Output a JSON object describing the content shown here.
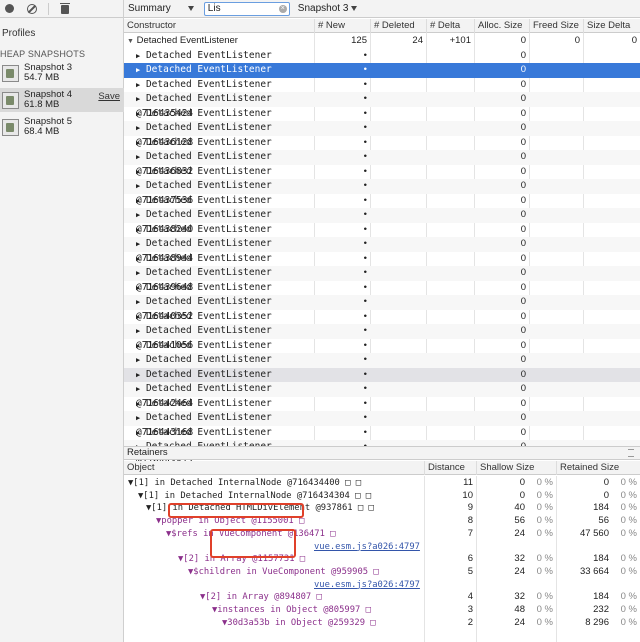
{
  "sidebar": {
    "profiles_label": "Profiles",
    "heap_label": "HEAP SNAPSHOTS",
    "snapshots": [
      {
        "name": "Snapshot 3",
        "size": "54.7 MB"
      },
      {
        "name": "Snapshot 4",
        "size": "61.8 MB",
        "save": "Save"
      },
      {
        "name": "Snapshot 5",
        "size": "68.4 MB"
      }
    ]
  },
  "toolbar": {
    "view": "Summary",
    "filter_value": "Lis",
    "compare": "Snapshot 3"
  },
  "table": {
    "headers": [
      "Constructor",
      "# New",
      "# Deleted",
      "# Delta",
      "Alloc. Size",
      "Freed Size",
      "Size Delta"
    ],
    "group": {
      "name": "Detached EventListener",
      "new": "125",
      "deleted": "24",
      "delta": "+101",
      "alloc": "0",
      "freed": "0",
      "size_delta": "0"
    },
    "rows": [
      "Detached EventListener @716434528",
      "Detached EventListener @716434720",
      "Detached EventListener @716435232",
      "Detached EventListener @716435424",
      "Detached EventListener @716435936",
      "Detached EventListener @716436128",
      "Detached EventListener @716436640",
      "Detached EventListener @716436832",
      "Detached EventListener @716437344",
      "Detached EventListener @716437536",
      "Detached EventListener @716438048",
      "Detached EventListener @716438240",
      "Detached EventListener @716438752",
      "Detached EventListener @716438944",
      "Detached EventListener @716439456",
      "Detached EventListener @716439648",
      "Detached EventListener @716440160",
      "Detached EventListener @716440352",
      "Detached EventListener @716440864",
      "Detached EventListener @716441056",
      "Detached EventListener @716441568",
      "Detached EventListener @716441760",
      "Detached EventListener @716442272",
      "Detached EventListener @716442464",
      "Detached EventListener @716442976",
      "Detached EventListener @716443168",
      "Detached EventListener @716443680",
      "Detached EventListener @716443872"
    ],
    "row_new": "•",
    "row_alloc": "0"
  },
  "retainers": {
    "title": "Retainers",
    "headers": [
      "Object",
      "Distance",
      "Shallow Size",
      "Retained Size"
    ],
    "rows": [
      {
        "obj": "▼[1] in Detached InternalNode @716434400 □ □",
        "dist": "11",
        "sh": "0",
        "shp": "0 %",
        "ret": "0",
        "retp": "0 %"
      },
      {
        "obj": "▼[1] in Detached InternalNode @716434304 □ □",
        "dist": "10",
        "sh": "0",
        "shp": "0 %",
        "ret": "0",
        "retp": "0 %"
      },
      {
        "obj": "▼[1] in Detached HTMLDivElement @937861 □ □",
        "dist": "9",
        "sh": "40",
        "shp": "0 %",
        "ret": "184",
        "retp": "0 %"
      },
      {
        "obj": "▼popper in Object @1155001 □",
        "dist": "8",
        "sh": "56",
        "shp": "0 %",
        "ret": "56",
        "retp": "0 %"
      },
      {
        "obj": "▼$refs in VueComponent @136471 □",
        "dist": "7",
        "sh": "24",
        "shp": "0 %",
        "ret": "47 560",
        "retp": "0 %"
      },
      {
        "obj": "vue.esm.js?a026:4797",
        "dist": "",
        "sh": "",
        "shp": "",
        "ret": "",
        "retp": ""
      },
      {
        "obj": "▼[2] in Array @1157731 □",
        "dist": "6",
        "sh": "32",
        "shp": "0 %",
        "ret": "184",
        "retp": "0 %"
      },
      {
        "obj": "▼$children in VueComponent @959905 □",
        "dist": "5",
        "sh": "24",
        "shp": "0 %",
        "ret": "33 664",
        "retp": "0 %"
      },
      {
        "obj": "vue.esm.js?a026:4797",
        "dist": "",
        "sh": "",
        "shp": "",
        "ret": "",
        "retp": ""
      },
      {
        "obj": "▼[2] in Array @894807 □",
        "dist": "4",
        "sh": "32",
        "shp": "0 %",
        "ret": "184",
        "retp": "0 %"
      },
      {
        "obj": "▼instances in Object @805997 □",
        "dist": "3",
        "sh": "48",
        "shp": "0 %",
        "ret": "232",
        "retp": "0 %"
      },
      {
        "obj": "▼30d3a53b in Object @259329 □",
        "dist": "2",
        "sh": "24",
        "shp": "0 %",
        "ret": "8 296",
        "retp": "0 %"
      }
    ]
  }
}
